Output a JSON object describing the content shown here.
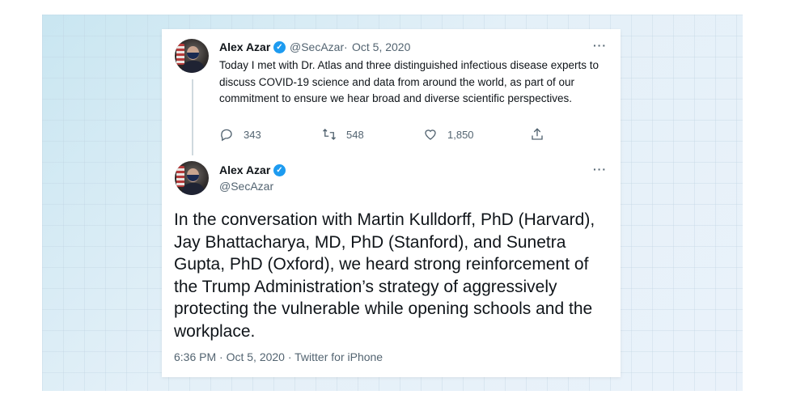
{
  "tweet1": {
    "name": "Alex Azar",
    "handle": "@SecAzar",
    "separator": "·",
    "date": "Oct 5, 2020",
    "more": "···",
    "text": "Today I met with Dr. Atlas and three distinguished infectious disease experts to discuss COVID-19 science and data from around the world, as part of our commitment to ensure we hear broad and diverse scientific perspectives.",
    "replies": "343",
    "retweets": "548",
    "likes": "1,850"
  },
  "tweet2": {
    "name": "Alex Azar",
    "handle": "@SecAzar",
    "more": "···",
    "text": "In the conversation with Martin Kulldorff, PhD (Harvard), Jay Bhattacharya, MD, PhD (Stanford), and Sunetra Gupta, PhD (Oxford), we heard strong reinforcement of the Trump Administration’s strategy of aggressively protecting the vulnerable while opening schools and the workplace.",
    "footer": "6:36 PM · Oct 5, 2020 · Twitter for iPhone"
  },
  "icons": {
    "verified": "verified-badge-icon",
    "reply": "reply-icon",
    "retweet": "retweet-icon",
    "like": "heart-icon",
    "share": "share-icon"
  },
  "colors": {
    "verified": "#1d9bf0",
    "text": "#0f1419",
    "secondary": "#536471",
    "background": "#e6f1f8"
  }
}
